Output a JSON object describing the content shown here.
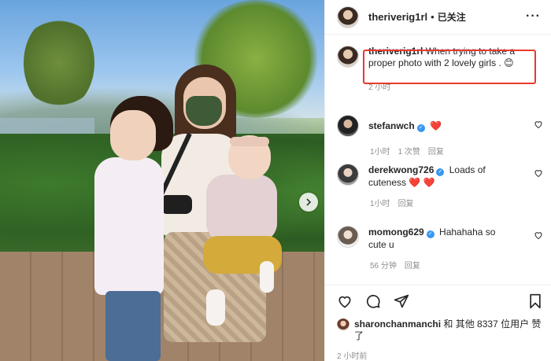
{
  "post": {
    "username": "theriverig1rl",
    "follow_status": "已关注",
    "more_label": "···"
  },
  "caption": {
    "username": "theriverig1rl",
    "text": "When trying to take a proper photo with 2 lovely girls . 😊",
    "time": "2 小时"
  },
  "comments": [
    {
      "username": "stefanwch",
      "text": "❤️",
      "time": "1小时",
      "likes": "1 次赞",
      "reply": "回复"
    },
    {
      "username": "derekwong726",
      "text": "Loads of cuteness ❤️ ❤️",
      "time": "1小时",
      "reply": "回复"
    },
    {
      "username": "momong629",
      "text": "Hahahaha so cute u",
      "time": "56 分钟",
      "reply": "回复"
    }
  ],
  "likes": {
    "user": "sharonchanmanchi",
    "text": "和 其他 8337 位用户 赞了"
  },
  "footer_time": "2 小时前",
  "colors": {
    "highlight_border": "#e8392b",
    "verified": "#3897f0"
  }
}
